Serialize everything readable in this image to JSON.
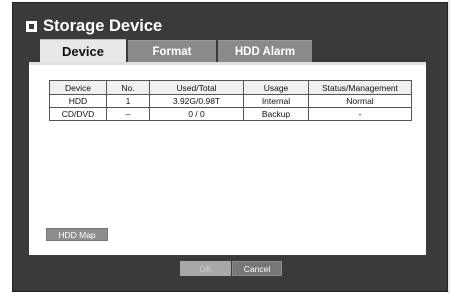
{
  "window": {
    "title": "Storage Device"
  },
  "tabs": [
    {
      "label": "Device",
      "active": true
    },
    {
      "label": "Format",
      "active": false
    },
    {
      "label": "HDD Alarm",
      "active": false
    }
  ],
  "table": {
    "headers": [
      "Device",
      "No.",
      "Used/Total",
      "Usage",
      "Status/Management"
    ],
    "rows": [
      [
        "HDD",
        "1",
        "3.92G/0.98T",
        "Internal",
        "Normal"
      ],
      [
        "CD/DVD",
        "–",
        "0 / 0",
        "Backup",
        "-"
      ]
    ]
  },
  "buttons": {
    "hdd_map": "HDD Map",
    "ok": "OK",
    "cancel": "Cancel"
  },
  "colors": {
    "background": "#3a3a3a",
    "panel": "#ffffff",
    "tab_active": "#e8e8e8",
    "tab_inactive": "#8a8a8a"
  }
}
